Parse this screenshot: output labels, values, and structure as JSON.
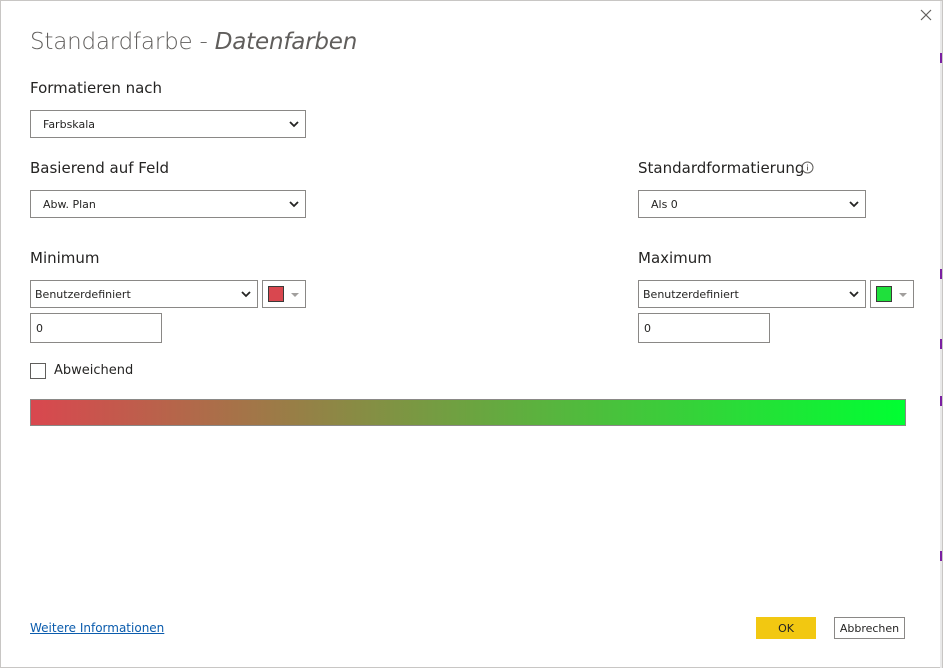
{
  "dialog": {
    "title_main": "Standardfarbe - ",
    "title_sub": "Datenfarben"
  },
  "format_by": {
    "label": "Formatieren nach",
    "value": "Farbskala"
  },
  "based_on": {
    "label": "Basierend auf Feld",
    "value": "Abw. Plan"
  },
  "default_formatting": {
    "label": "Standardformatierung",
    "value": "Als 0"
  },
  "minimum": {
    "label": "Minimum",
    "type_value": "Benutzerdefiniert",
    "color": "#d9474f",
    "value": "0"
  },
  "maximum": {
    "label": "Maximum",
    "type_value": "Benutzerdefiniert",
    "color": "#1fe03c",
    "value": "0"
  },
  "diverging": {
    "label": "Abweichend",
    "checked": false
  },
  "gradient": {
    "start_color": "#d9474f",
    "end_color": "#00ff32"
  },
  "footer": {
    "learn_more": "Weitere Informationen",
    "ok": "OK",
    "cancel": "Abbrechen"
  },
  "colors": {
    "accent_button": "#f2c811",
    "link": "#0b5cad"
  },
  "icons": {
    "close": "close-icon",
    "info": "info-icon",
    "dropdown": "chevron-down-icon"
  }
}
